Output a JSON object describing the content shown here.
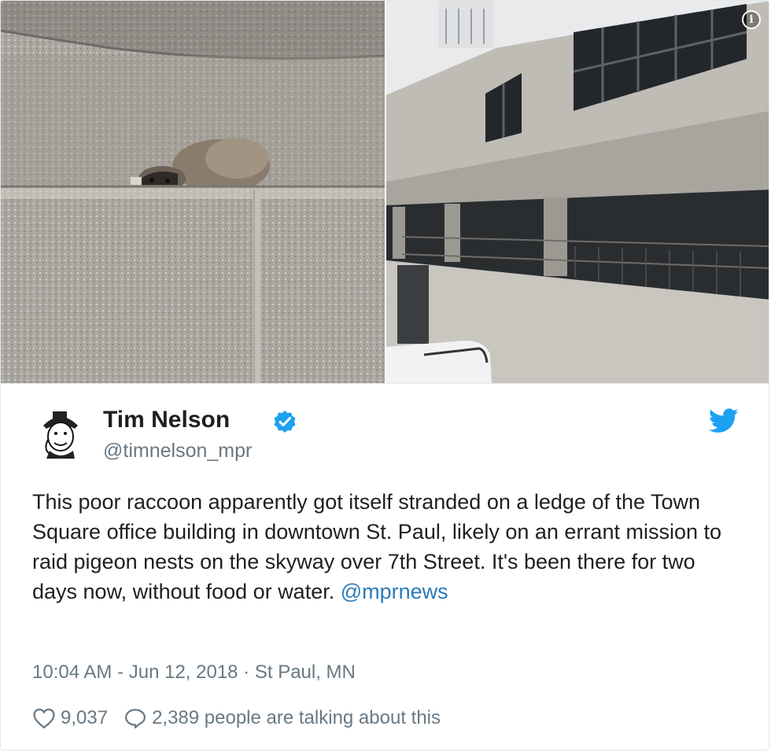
{
  "author": {
    "name": "Tim Nelson",
    "handle": "@timnelson_mpr"
  },
  "tweet": {
    "text": "This poor raccoon apparently got itself stranded on a ledge of the Town Square office building in downtown St. Paul, likely on an errant mission to raid pigeon nests on the skyway over 7th Street. It's been there for two days now, without food or water. ",
    "mention": "@mprnews",
    "timestamp": "10:04 AM - Jun 12, 2018 · St Paul, MN"
  },
  "engagement": {
    "likes": "9,037",
    "talking": "2,389 people are talking about this"
  },
  "icons": {
    "info": "info-icon",
    "verified": "verified-badge-icon",
    "twitter": "twitter-bird-icon",
    "like": "heart-icon",
    "reply": "speech-bubble-icon"
  },
  "colors": {
    "link": "#2b7bb9",
    "verified": "#1da1f2",
    "muted": "#697882",
    "text": "#1c2022"
  }
}
